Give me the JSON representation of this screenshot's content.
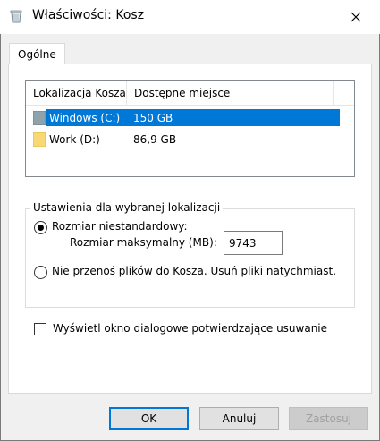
{
  "window": {
    "title": "Właściwości: Kosz"
  },
  "tabs": [
    {
      "label": "Ogólne"
    }
  ],
  "list": {
    "columns": [
      "Lokalizacja Kosza",
      "Dostępne miejsce"
    ],
    "rows": [
      {
        "name": "Windows (C:)",
        "space": "150 GB",
        "icon": "drive-icon",
        "selected": true
      },
      {
        "name": "Work (D:)",
        "space": "86,9 GB",
        "icon": "folder-icon",
        "selected": false
      }
    ]
  },
  "settings": {
    "group_label": "Ustawienia dla wybranej lokalizacji",
    "custom_size_label": "Rozmiar niestandardowy:",
    "max_size_label": "Rozmiar maksymalny (MB):",
    "max_size_value": "9743",
    "no_recycle_label": "Nie przenoś plików do Kosza. Usuń pliki natychmiast."
  },
  "confirm_checkbox": {
    "label": "Wyświetl okno dialogowe potwierdzające usuwanie",
    "checked": false
  },
  "buttons": {
    "ok": "OK",
    "cancel": "Anuluj",
    "apply": "Zastosuj"
  },
  "colors": {
    "selection": "#0078d7",
    "window_bg": "#f0f0f0",
    "panel_bg": "#ffffff"
  }
}
